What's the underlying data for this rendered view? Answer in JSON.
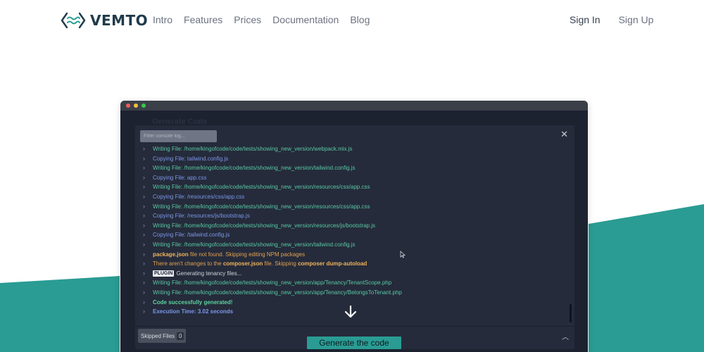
{
  "nav": {
    "logo_text": "VEMTO",
    "menu": [
      {
        "label": "Intro"
      },
      {
        "label": "Features"
      },
      {
        "label": "Prices"
      },
      {
        "label": "Documentation"
      },
      {
        "label": "Blog"
      }
    ],
    "sign_in": "Sign In",
    "sign_up": "Sign Up"
  },
  "app": {
    "background_title": "Generate Code",
    "filter_placeholder": "Filter console log...",
    "close_glyph": "✕",
    "log": [
      {
        "style": "g",
        "text": "Writing File: /home/kingofcode/code/tests/showing_new_version/webpack.mix.js"
      },
      {
        "style": "b",
        "text": "Copying File: tailwind.config.js"
      },
      {
        "style": "g",
        "text": "Writing File: /home/kingofcode/code/tests/showing_new_version/tailwind.config.js"
      },
      {
        "style": "b",
        "text": "Copying File: app.css"
      },
      {
        "style": "g",
        "text": "Writing File: /home/kingofcode/code/tests/showing_new_version/resources/css/app.css"
      },
      {
        "style": "b",
        "text": "Copying File: /resources/css/app.css"
      },
      {
        "style": "g",
        "text": "Writing File: /home/kingofcode/code/tests/showing_new_version/resources/css/app.css"
      },
      {
        "style": "b",
        "text": "Copying File: /resources/js/bootstrap.js"
      },
      {
        "style": "g",
        "text": "Writing File: /home/kingofcode/code/tests/showing_new_version/resources/js/bootstrap.js"
      },
      {
        "style": "b",
        "text": "Copying File: /tailwind.config.js"
      },
      {
        "style": "g",
        "text": "Writing File: /home/kingofcode/code/tests/showing_new_version/tailwind.config.js"
      }
    ],
    "warn1": {
      "bold": "package.json",
      "rest": " file not found. Skipping editing NPM packages"
    },
    "warn2": {
      "pre": "There aren't changes to the ",
      "bold1": "composer.json",
      "mid": " file. Skipping ",
      "bold2": "composer dump-autoload"
    },
    "plugin": {
      "badge": "PLUGIN",
      "text": "Generating tenancy files..."
    },
    "log2": [
      {
        "style": "g",
        "text": "Writing File: /home/kingofcode/code/tests/showing_new_version/app/Tenancy/TenantScope.php"
      },
      {
        "style": "g",
        "text": "Writing File: /home/kingofcode/code/tests/showing_new_version/app/Tenancy/BelongsToTenant.php"
      }
    ],
    "success": "Code successfully generated!",
    "exec_time": "Execution Time: 3.02 seconds",
    "skipped_label": "Skipped Files",
    "skipped_count": "0",
    "generate_label": "Generate the code"
  },
  "colors": {
    "teal": "#2a9c93",
    "console_bg": "#252b3b",
    "green_text": "#59c8a3",
    "blue_text": "#7c96e8",
    "orange_text": "#e2a04f"
  },
  "icons": [
    "vemto-logo-icon",
    "close-icon",
    "chevron-right-icon",
    "arrow-down-icon",
    "chevron-up-icon",
    "mouse-cursor-icon"
  ]
}
